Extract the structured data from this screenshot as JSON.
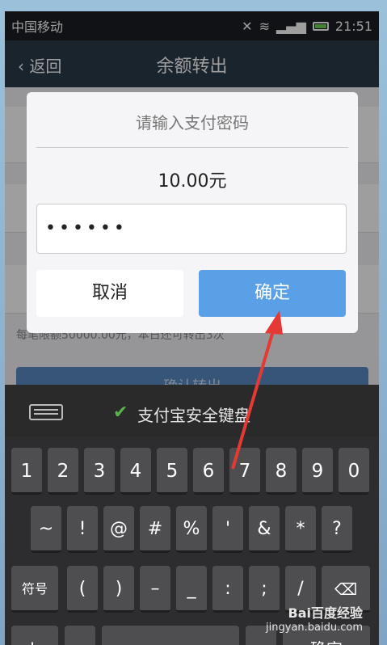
{
  "status_bar": {
    "carrier": "中国移动",
    "time": "21:51"
  },
  "title_bar": {
    "back_label": "返回",
    "title": "余额转出"
  },
  "background": {
    "hint": "每笔限额50000.00元，本日还可转出3次",
    "confirm_label": "确认转出"
  },
  "dialog": {
    "title": "请输入支付密码",
    "amount": "10.00元",
    "password_mask": "••••••",
    "cancel_label": "取消",
    "confirm_label": "确定"
  },
  "keyboard": {
    "header_label": "支付宝安全键盘",
    "row1": [
      "1",
      "2",
      "3",
      "4",
      "5",
      "6",
      "7",
      "8",
      "9",
      "0"
    ],
    "row2": [
      "~",
      "!",
      "@",
      "#",
      "%",
      "'",
      "&",
      "*",
      "?"
    ],
    "row3": [
      "符号",
      "(",
      ")",
      "–",
      "_",
      ":",
      ";",
      "/"
    ],
    "row4": [
      "abc",
      "确定"
    ]
  },
  "watermark": {
    "brand": "Bai百度经验",
    "url": "jingyan.baidu.com"
  },
  "colors": {
    "confirm_button": "#5aa0e6",
    "shield": "#58b34a",
    "arrow": "#e53935"
  }
}
